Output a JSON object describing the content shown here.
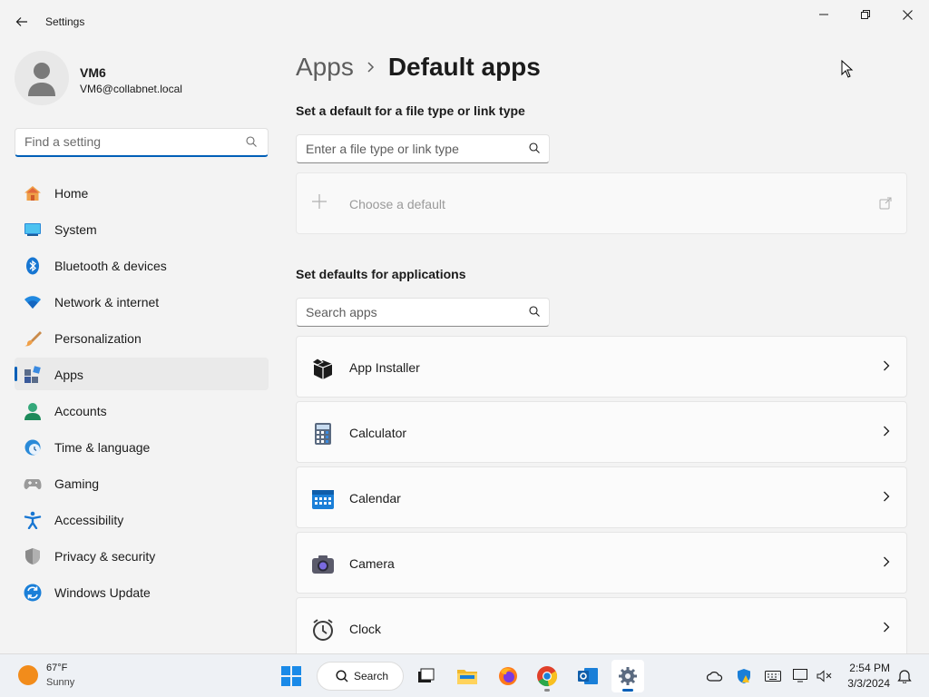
{
  "window": {
    "title": "Settings"
  },
  "profile": {
    "name": "VM6",
    "email": "VM6@collabnet.local"
  },
  "search": {
    "placeholder": "Find a setting"
  },
  "sidebar": {
    "items": [
      {
        "label": "Home",
        "icon": "home-icon"
      },
      {
        "label": "System",
        "icon": "system-icon"
      },
      {
        "label": "Bluetooth & devices",
        "icon": "bluetooth-icon"
      },
      {
        "label": "Network & internet",
        "icon": "wifi-icon"
      },
      {
        "label": "Personalization",
        "icon": "brush-icon"
      },
      {
        "label": "Apps",
        "icon": "apps-icon",
        "active": true
      },
      {
        "label": "Accounts",
        "icon": "account-icon"
      },
      {
        "label": "Time & language",
        "icon": "clock-globe-icon"
      },
      {
        "label": "Gaming",
        "icon": "gamepad-icon"
      },
      {
        "label": "Accessibility",
        "icon": "accessibility-icon"
      },
      {
        "label": "Privacy & security",
        "icon": "shield-icon"
      },
      {
        "label": "Windows Update",
        "icon": "update-icon"
      }
    ]
  },
  "breadcrumb": {
    "parent": "Apps",
    "separator": "›",
    "current": "Default apps"
  },
  "file_type_section": {
    "title": "Set a default for a file type or link type",
    "search_placeholder": "Enter a file type or link type",
    "choose_label": "Choose a default"
  },
  "apps_section": {
    "title": "Set defaults for applications",
    "search_placeholder": "Search apps",
    "apps": [
      {
        "label": "App Installer",
        "icon": "app-installer-icon"
      },
      {
        "label": "Calculator",
        "icon": "calculator-icon"
      },
      {
        "label": "Calendar",
        "icon": "calendar-icon"
      },
      {
        "label": "Camera",
        "icon": "camera-icon"
      },
      {
        "label": "Clock",
        "icon": "clock-icon"
      }
    ]
  },
  "taskbar": {
    "weather_temp": "67°F",
    "weather_cond": "Sunny",
    "search_label": "Search",
    "time": "2:54 PM",
    "date": "3/3/2024"
  },
  "colors": {
    "accent": "#005fb8",
    "background": "#f3f3f3"
  }
}
